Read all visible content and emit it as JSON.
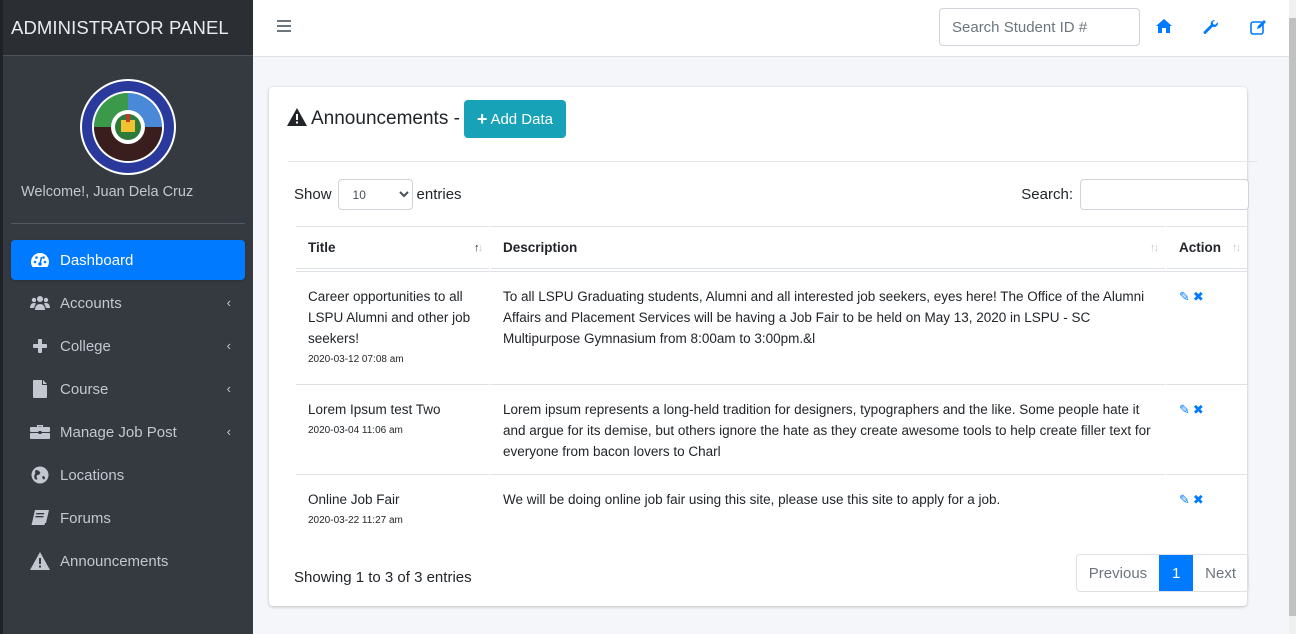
{
  "sidebar": {
    "brand": "ADMINISTRATOR PANEL",
    "logo_alt": "Laguna State Polytechnic University seal",
    "welcome": "Welcome!, Juan Dela Cruz",
    "items": [
      {
        "label": "Dashboard",
        "icon": "dashboard-icon",
        "active": true,
        "has_submenu": false
      },
      {
        "label": "Accounts",
        "icon": "users-icon",
        "active": false,
        "has_submenu": true
      },
      {
        "label": "College",
        "icon": "plus-icon",
        "active": false,
        "has_submenu": true
      },
      {
        "label": "Course",
        "icon": "file-icon",
        "active": false,
        "has_submenu": true
      },
      {
        "label": "Manage Job Post",
        "icon": "briefcase-icon",
        "active": false,
        "has_submenu": true
      },
      {
        "label": "Locations",
        "icon": "globe-icon",
        "active": false,
        "has_submenu": false
      },
      {
        "label": "Forums",
        "icon": "book-icon",
        "active": false,
        "has_submenu": false
      },
      {
        "label": "Announcements",
        "icon": "warning-icon",
        "active": false,
        "has_submenu": false
      }
    ],
    "chevron": "‹"
  },
  "topbar": {
    "search_placeholder": "Search Student ID #",
    "icons": [
      "home-icon",
      "wrench-icon",
      "edit-icon"
    ]
  },
  "card": {
    "title": "Announcements -",
    "add_button": "Add Data",
    "length": {
      "show_label": "Show",
      "selected": "10",
      "entries_label": "entries"
    },
    "search_label": "Search:",
    "search_value": "",
    "columns": [
      "Title",
      "Description",
      "Action"
    ],
    "rows": [
      {
        "title": "Career opportunities to all LSPU Alumni and other job seekers!",
        "timestamp": "2020-03-12 07:08 am",
        "description": "To all LSPU Graduating students, Alumni and all interested job seekers, eyes here! The Office of the Alumni Affairs and Placement Services will be having a Job Fair to be held on May 13, 2020 in LSPU - SC Multipurpose Gymnasium from 8:00am to 3:00pm.&l"
      },
      {
        "title": "Lorem Ipsum test Two",
        "timestamp": "2020-03-04 11:06 am",
        "description": "Lorem ipsum represents a long-held tradition for designers, typographers and the like. Some people hate it and argue for its demise, but others ignore the hate as they create awesome tools to help create filler text for everyone from bacon lovers to Charl"
      },
      {
        "title": "Online Job Fair",
        "timestamp": "2020-03-22 11:27 am",
        "description": "We will be doing online job fair using this site, please use this site to apply for a job."
      }
    ],
    "info": "Showing 1 to 3 of 3 entries",
    "pagination": {
      "previous": "Previous",
      "current": "1",
      "next": "Next"
    }
  },
  "colors": {
    "sidebar_bg": "#343a40",
    "active": "#007bff",
    "add_button": "#17a2b8",
    "action_icons": "#007bff"
  }
}
